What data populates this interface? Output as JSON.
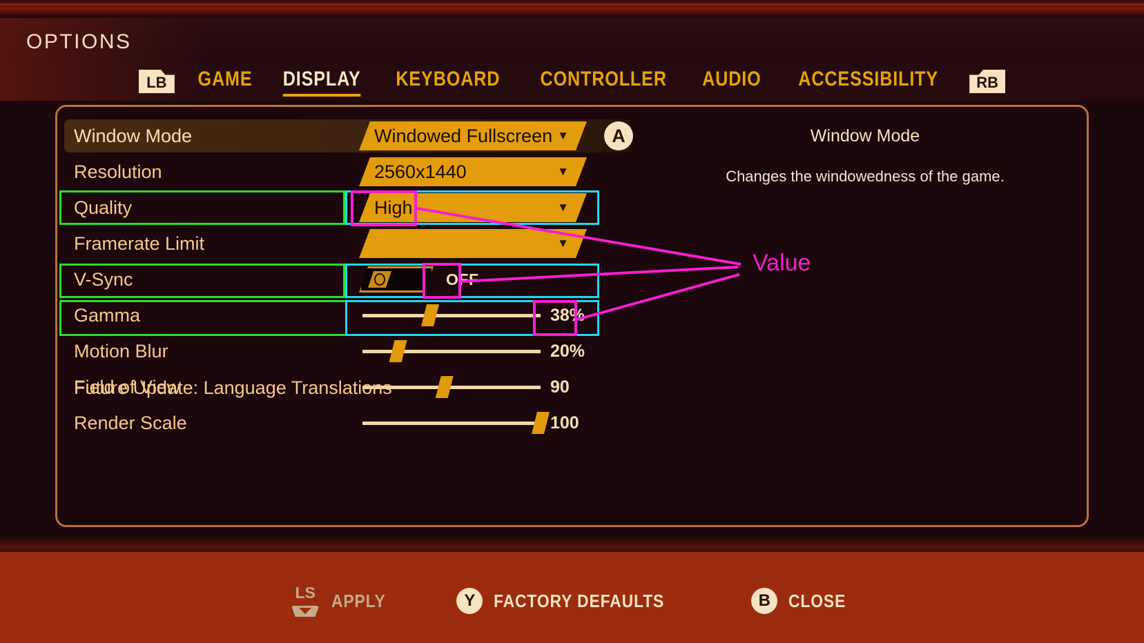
{
  "window": {
    "title": "OPTIONS"
  },
  "tabs": {
    "prev_bumper": "LB",
    "next_bumper": "RB",
    "items": [
      {
        "label": "GAME",
        "active": false
      },
      {
        "label": "DISPLAY",
        "active": true
      },
      {
        "label": "KEYBOARD",
        "active": false
      },
      {
        "label": "CONTROLLER",
        "active": false
      },
      {
        "label": "AUDIO",
        "active": false
      },
      {
        "label": "ACCESSIBILITY",
        "active": false
      }
    ]
  },
  "settings": {
    "rows": [
      {
        "label": "Window Mode",
        "type": "dropdown",
        "value": "Windowed Fullscreen",
        "caret": "▼",
        "selected": true,
        "confirm_glyph": "A"
      },
      {
        "label": "Resolution",
        "type": "dropdown",
        "value": "2560x1440",
        "caret": "▼",
        "selected": false
      },
      {
        "label": "Quality",
        "type": "dropdown",
        "value": "High",
        "caret": "▼",
        "selected": false
      },
      {
        "label": "Framerate Limit",
        "type": "dropdown",
        "value": "",
        "caret": "▼",
        "selected": false
      },
      {
        "label": "V-Sync",
        "type": "toggle",
        "value": "OFF",
        "on": false,
        "selected": false
      },
      {
        "label": "Gamma",
        "type": "slider",
        "value": "38%",
        "percent": 38,
        "selected": false
      },
      {
        "label": "Motion Blur",
        "type": "slider",
        "value": "20%",
        "percent": 20,
        "selected": false
      },
      {
        "label": "Field of View",
        "type": "slider",
        "value": "90",
        "percent": 46,
        "selected": false
      },
      {
        "label": "Render Scale",
        "type": "slider",
        "value": "100",
        "percent": 100,
        "selected": false
      }
    ],
    "future_note": "Future Update: Language Translations"
  },
  "description": {
    "title": "Window Mode",
    "body": "Changes the windowedness of the game."
  },
  "footer": {
    "prompts": [
      {
        "glyph": "LS",
        "glyph_type": "stick",
        "label": "APPLY",
        "dim": true
      },
      {
        "glyph": "Y",
        "glyph_type": "round",
        "label": "FACTORY DEFAULTS",
        "dim": false
      },
      {
        "glyph": "B",
        "glyph_type": "round",
        "label": "CLOSE",
        "dim": false
      }
    ]
  },
  "annotations": {
    "label": "Value",
    "colors": {
      "label_box": "#28e028",
      "control_box": "#1fd8ef",
      "value_box": "#f51fd0"
    }
  }
}
